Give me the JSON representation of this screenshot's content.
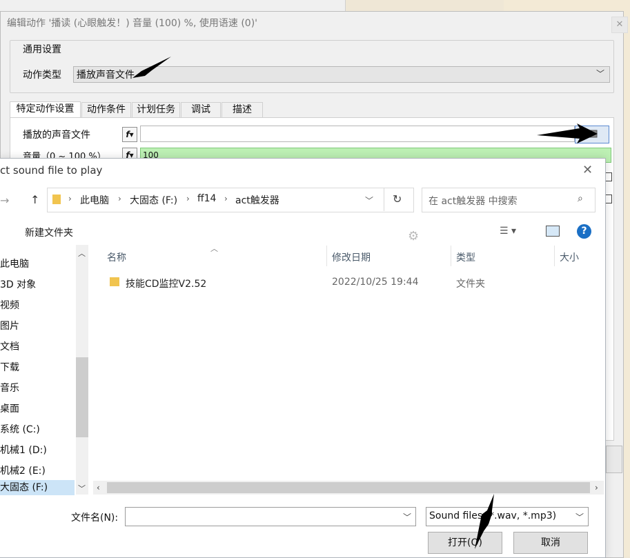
{
  "dialog": {
    "title": "编辑动作 '播读 (心眼触发！) 音量 (100) %, 使用语速 (0)'",
    "group_label": "通用设置",
    "action_type_label": "动作类型",
    "action_type_value": "播放声音文件",
    "tabs": [
      "特定动作设置",
      "动作条件",
      "计划任务",
      "调试",
      "描述"
    ],
    "sound_file_label": "播放的声音文件",
    "volume_label": "音量（0 ~ 100 %）",
    "volume_value": "100",
    "fx_icon": "fx-icon"
  },
  "file_dialog": {
    "title": "ct sound file to play",
    "path": [
      "此电脑",
      "大固态 (F:)",
      "ff14",
      "act触发器"
    ],
    "search_placeholder": "在 act触发器 中搜索",
    "new_folder": "新建文件夹",
    "nav_items": [
      "此电脑",
      "3D 对象",
      "视频",
      "图片",
      "文档",
      "下载",
      "音乐",
      "桌面",
      "系统 (C:)",
      "机械1 (D:)",
      "机械2 (E:)",
      "大固态 (F:)"
    ],
    "columns": [
      "名称",
      "修改日期",
      "类型",
      "大小"
    ],
    "files": [
      {
        "name": "技能CD监控V2.52",
        "date": "2022/10/25 19:44",
        "type": "文件夹",
        "size": ""
      }
    ],
    "filename_label": "文件名(N):",
    "filename_value": "",
    "filter": "Sound files (*.wav, *.mp3)",
    "open_button": "打开(O)",
    "cancel_button": "取消"
  },
  "colors": {
    "volume_bg": "#bdf0b4",
    "selected_nav": "#cce4f7",
    "help_icon": "#1a6fc5"
  }
}
